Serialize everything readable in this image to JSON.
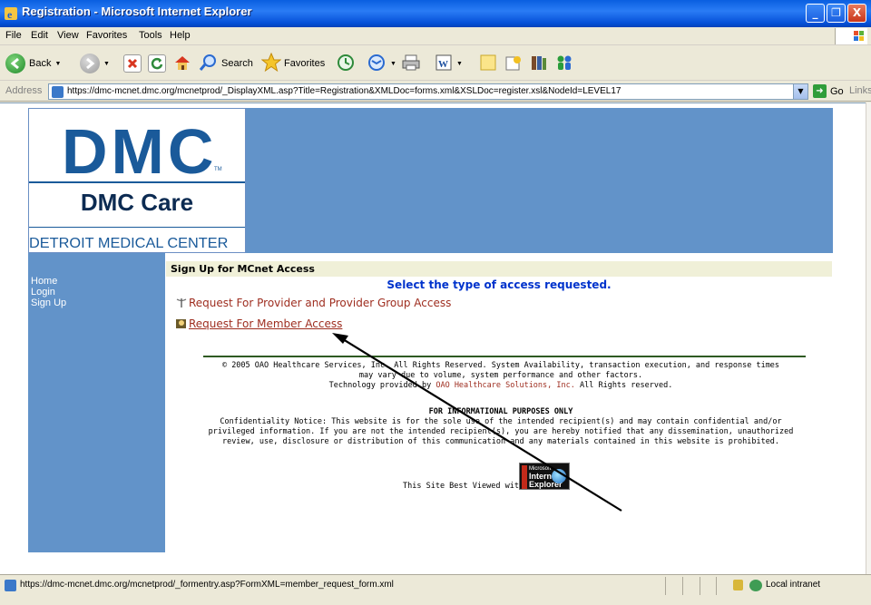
{
  "window": {
    "title": "Registration - Microsoft Internet Explorer",
    "minimize": "_",
    "maximize": "❐",
    "close": "X"
  },
  "menu": [
    "File",
    "Edit",
    "View",
    "Favorites",
    "Tools",
    "Help"
  ],
  "toolbar": {
    "back": "Back",
    "search": "Search",
    "favorites": "Favorites"
  },
  "address": {
    "label": "Address",
    "url": "https://dmc-mcnet.dmc.org/mcnetprod/_DisplayXML.asp?Title=Registration&XMLDoc=forms.xml&XSLDoc=register.xsl&NodeId=LEVEL17",
    "go": "Go",
    "links": "Links"
  },
  "logo": {
    "brand": "DMC",
    "tm": "TM",
    "care": "DMC Care",
    "center": "DETROIT MEDICAL CENTER"
  },
  "sidebar": {
    "items": [
      "Home",
      "Login",
      "Sign Up"
    ]
  },
  "main": {
    "header": "Sign Up for MCnet Access",
    "prompt": "Select the type of access requested.",
    "provider_link": "Request For Provider and Provider Group Access",
    "member_link": "Request For Member Access"
  },
  "footer": {
    "copyright_1": "© 2005 OAO Healthcare Services, Inc. All Rights Reserved. System Availability, transaction execution, and response times",
    "copyright_2": "may vary due to volume, system performance and other factors.",
    "tech_prefix": "Technology provided by ",
    "tech_company": "OAO Healthcare Solutions, Inc.",
    "tech_suffix": " All Rights reserved.",
    "info_title": "FOR INFORMATIONAL PURPOSES ONLY",
    "conf_1": "Confidentiality Notice: This website is for the sole use of the intended recipient(s) and may contain confidential and/or",
    "conf_2": "privileged information. If you are not the intended recipient(s), you are hereby notified that any dissemination, unauthorized",
    "conf_3": "review, use, disclosure or distribution of this communication and any materials contained in this website is prohibited.",
    "best_viewed": "This Site Best Viewed with:",
    "badge_1": "Microsoft",
    "badge_2": "Internet",
    "badge_3": "Explorer"
  },
  "status": {
    "url": "https://dmc-mcnet.dmc.org/mcnetprod/_formentry.asp?FormXML=member_request_form.xml",
    "zone": "Local intranet"
  },
  "colors": {
    "banner": "#6293c9",
    "link": "#9e2d1f",
    "prompt": "#0033cc",
    "brand": "#1a5a9a"
  }
}
